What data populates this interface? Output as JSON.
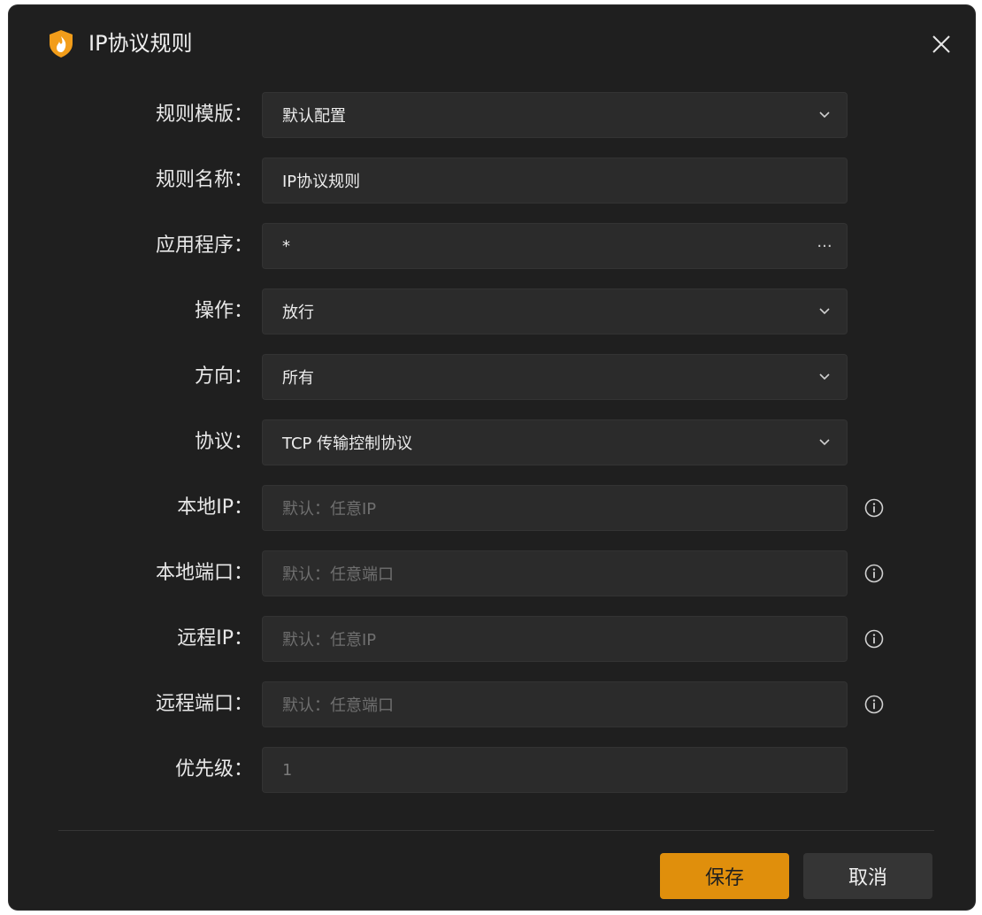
{
  "dialog": {
    "title": "IP协议规则",
    "icon": "shield-flame-icon",
    "accent_color": "#e08f0c"
  },
  "form": {
    "template": {
      "label": "规则模版：",
      "value": "默认配置",
      "type": "dropdown"
    },
    "name": {
      "label": "规则名称：",
      "value": "IP协议规则",
      "type": "text"
    },
    "application": {
      "label": "应用程序：",
      "value": "*",
      "suffix": "···",
      "type": "browse"
    },
    "action": {
      "label": "操作：",
      "value": "放行",
      "type": "dropdown"
    },
    "direction": {
      "label": "方向：",
      "value": "所有",
      "type": "dropdown"
    },
    "protocol": {
      "label": "协议：",
      "value": "TCP 传输控制协议",
      "type": "dropdown"
    },
    "local_ip": {
      "label": "本地IP：",
      "placeholder": "默认：任意IP",
      "type": "text"
    },
    "local_port": {
      "label": "本地端口：",
      "placeholder": "默认：任意端口",
      "type": "text"
    },
    "remote_ip": {
      "label": "远程IP：",
      "placeholder": "默认：任意IP",
      "type": "text"
    },
    "remote_port": {
      "label": "远程端口：",
      "placeholder": "默认：任意端口",
      "type": "text"
    },
    "priority": {
      "label": "优先级：",
      "value": "1",
      "type": "number"
    }
  },
  "buttons": {
    "save": "保存",
    "cancel": "取消"
  }
}
